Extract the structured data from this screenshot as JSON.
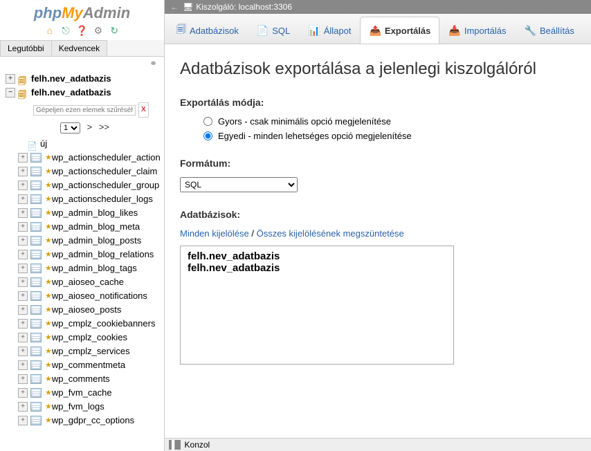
{
  "logo": {
    "p1": "php",
    "p2": "My",
    "p3": "Admin"
  },
  "nav_tabs": {
    "recent": "Legutóbbi",
    "favs": "Kedvencek"
  },
  "filter": {
    "placeholder": "Gépeljen ezen elemek szűréséhez",
    "x": "X"
  },
  "page": {
    "sel": "1",
    "next": ">",
    "last": ">>"
  },
  "dbs": {
    "db1": "felh.nev_adatbazis",
    "db2": "felh.nev_adatbazis",
    "new": "új",
    "tables": [
      "wp_actionscheduler_action",
      "wp_actionscheduler_claim",
      "wp_actionscheduler_group",
      "wp_actionscheduler_logs",
      "wp_admin_blog_likes",
      "wp_admin_blog_meta",
      "wp_admin_blog_posts",
      "wp_admin_blog_relations",
      "wp_admin_blog_tags",
      "wp_aioseo_cache",
      "wp_aioseo_notifications",
      "wp_aioseo_posts",
      "wp_cmplz_cookiebanners",
      "wp_cmplz_cookies",
      "wp_cmplz_services",
      "wp_commentmeta",
      "wp_comments",
      "wp_fvm_cache",
      "wp_fvm_logs",
      "wp_gdpr_cc_options"
    ]
  },
  "server": {
    "label": "Kiszolgáló: localhost:3306"
  },
  "tabs": {
    "db": "Adatbázisok",
    "sql": "SQL",
    "status": "Állapot",
    "export": "Exportálás",
    "import": "Importálás",
    "settings": "Beállítás"
  },
  "page_title": "Adatbázisok exportálása a jelenlegi kiszolgálóról",
  "export_mode_label": "Exportálás módja:",
  "radio": {
    "quick": "Gyors - csak minimális opció megjelenítése",
    "custom": "Egyedi - minden lehetséges opció megjelenítése"
  },
  "format_label": "Formátum:",
  "format_value": "SQL",
  "dbs_label": "Adatbázisok:",
  "select_all": "Minden kijelölése",
  "deselect_all": "Összes kijelölésének megszüntetése",
  "db_list": {
    "i0": "felh.nev_adatbazis",
    "i1": "felh.nev_adatbazis"
  },
  "konzol": "Konzol"
}
